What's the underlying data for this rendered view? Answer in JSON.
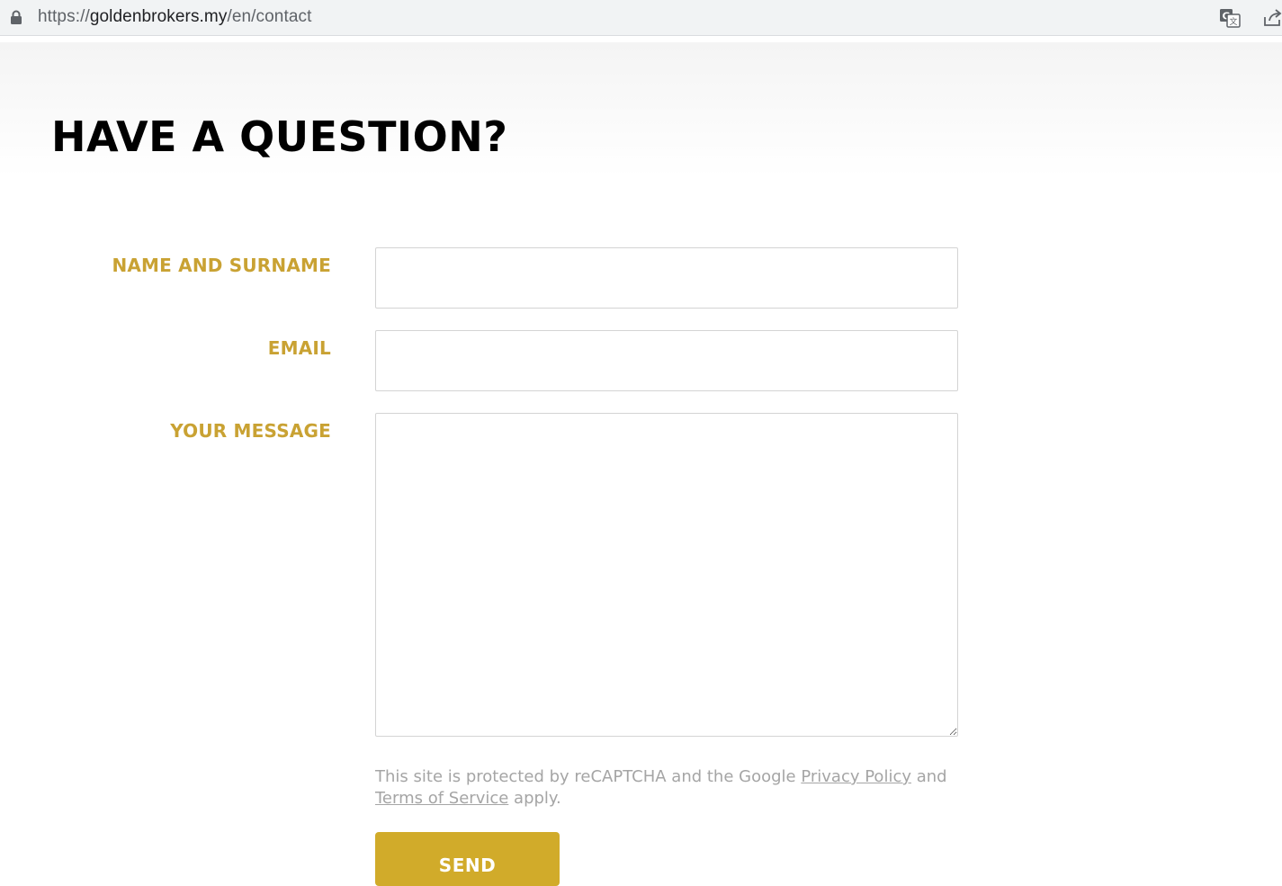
{
  "browser": {
    "url_scheme": "https://",
    "url_host": "goldenbrokers.my",
    "url_path": "/en/contact",
    "icons": [
      "lock-icon",
      "translate-icon",
      "share-icon"
    ]
  },
  "page": {
    "title": "HAVE A QUESTION?"
  },
  "form": {
    "name_label": "NAME AND SURNAME",
    "name_value": "",
    "email_label": "EMAIL",
    "email_value": "",
    "message_label": "YOUR MESSAGE",
    "message_value": "",
    "recaptcha_prefix": "This site is protected by reCAPTCHA and the Google ",
    "privacy_link": "Privacy Policy",
    "recaptcha_and": " and ",
    "terms_link": "Terms of Service",
    "recaptcha_suffix": " apply.",
    "send_label": "SEND"
  },
  "colors": {
    "accent_gold": "#c9a233",
    "button_gold": "#d1ab2a",
    "muted_text": "#a5a5a5"
  }
}
